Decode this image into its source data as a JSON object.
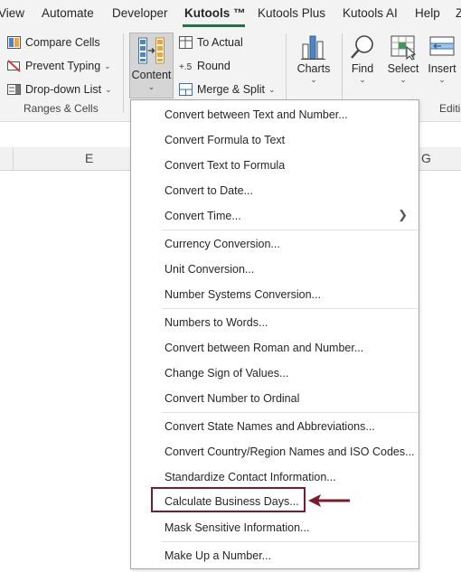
{
  "menubar": {
    "tabs": [
      {
        "label": "View",
        "active": false
      },
      {
        "label": "Automate",
        "active": false
      },
      {
        "label": "Developer",
        "active": false
      },
      {
        "label": "Kutools ™",
        "active": true
      },
      {
        "label": "Kutools Plus",
        "active": false
      },
      {
        "label": "Kutools AI",
        "active": false
      },
      {
        "label": "Help",
        "active": false
      },
      {
        "label": "Z",
        "active": false
      }
    ]
  },
  "ribbon": {
    "ranges_cells": {
      "compare_cells": "Compare Cells",
      "prevent_typing": "Prevent Typing",
      "dropdown_list": "Drop-down List",
      "group_label": "Ranges & Cells"
    },
    "content": {
      "label": "Content"
    },
    "to_actual": "To Actual",
    "round": "Round",
    "merge_split": "Merge & Split",
    "charts": "Charts",
    "find": "Find",
    "select": "Select",
    "insert": "Insert",
    "editing_label": "Editi"
  },
  "sheet": {
    "columns": [
      "E",
      "G"
    ]
  },
  "menu": {
    "items": [
      "Convert between Text and Number...",
      "Convert Formula to Text",
      "Convert Text to Formula",
      "Convert to Date...",
      "Convert Time...",
      "Currency Conversion...",
      "Unit Conversion...",
      "Number Systems Conversion...",
      "Numbers to Words...",
      "Convert between Roman and Number...",
      "Change Sign of Values...",
      "Convert Number to Ordinal",
      "Convert State Names and Abbreviations...",
      "Convert Country/Region Names and ISO Codes...",
      "Standardize Contact Information...",
      "Calculate Business Days...",
      "Mask Sensitive Information...",
      "Make Up a Number..."
    ],
    "highlighted_item": "Calculate Business Days...",
    "highlight_color": "#7b1c2e"
  },
  "colors": {
    "ribbon_bg": "#f3f3f3",
    "accent_green": "#217346",
    "annotation": "#7b1c2e"
  }
}
